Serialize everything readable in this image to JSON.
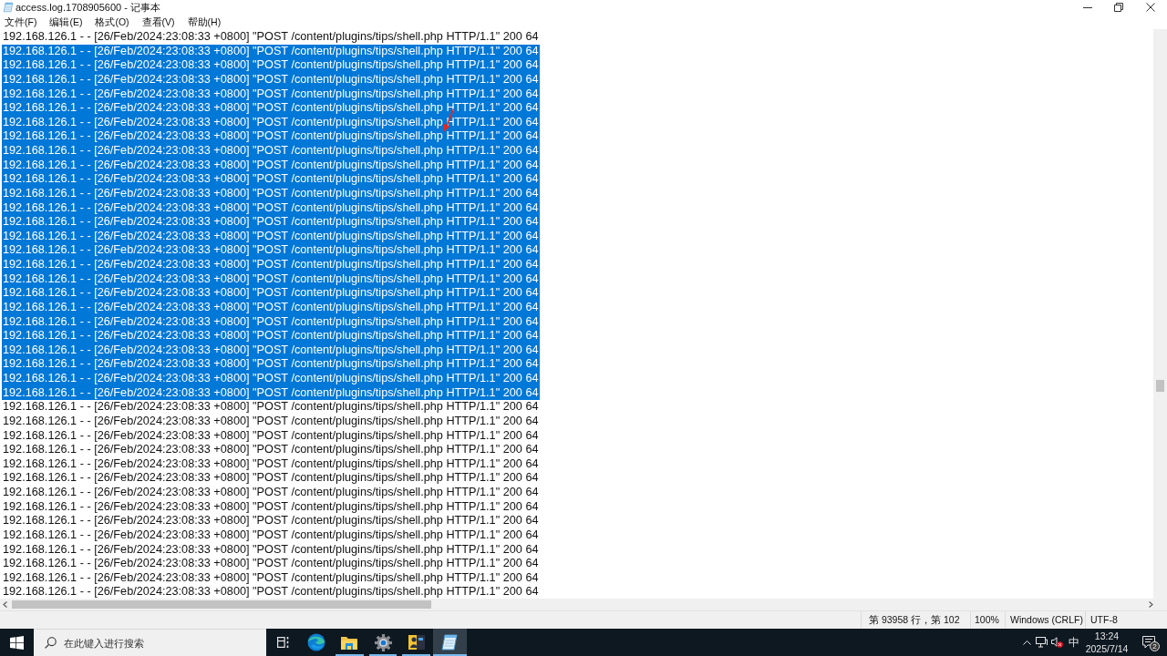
{
  "window": {
    "title": "access.log.1708905600 - 记事本"
  },
  "menu": [
    {
      "label": "文件(F)"
    },
    {
      "label": "编辑(E)"
    },
    {
      "label": "格式(O)"
    },
    {
      "label": "查看(V)"
    },
    {
      "label": "帮助(H)"
    }
  ],
  "editor": {
    "lines": [
      {
        "text": "192.168.126.1 - - [26/Feb/2024:23:08:33 +0800] \"POST /content/plugins/tips/shell.php HTTP/1.1\" 200 64",
        "selected": false
      },
      {
        "text": "192.168.126.1 - - [26/Feb/2024:23:08:33 +0800] \"POST /content/plugins/tips/shell.php HTTP/1.1\" 200 64",
        "selected": true
      },
      {
        "text": "192.168.126.1 - - [26/Feb/2024:23:08:33 +0800] \"POST /content/plugins/tips/shell.php HTTP/1.1\" 200 64",
        "selected": true
      },
      {
        "text": "192.168.126.1 - - [26/Feb/2024:23:08:33 +0800] \"POST /content/plugins/tips/shell.php HTTP/1.1\" 200 64",
        "selected": true
      },
      {
        "text": "192.168.126.1 - - [26/Feb/2024:23:08:33 +0800] \"POST /content/plugins/tips/shell.php HTTP/1.1\" 200 64",
        "selected": true
      },
      {
        "text": "192.168.126.1 - - [26/Feb/2024:23:08:33 +0800] \"POST /content/plugins/tips/shell.php HTTP/1.1\" 200 64",
        "selected": true
      },
      {
        "text": "192.168.126.1 - - [26/Feb/2024:23:08:33 +0800] \"POST /content/plugins/tips/shell.php HTTP/1.1\" 200 64",
        "selected": true
      },
      {
        "text": "192.168.126.1 - - [26/Feb/2024:23:08:33 +0800] \"POST /content/plugins/tips/shell.php HTTP/1.1\" 200 64",
        "selected": true
      },
      {
        "text": "192.168.126.1 - - [26/Feb/2024:23:08:33 +0800] \"POST /content/plugins/tips/shell.php HTTP/1.1\" 200 64",
        "selected": true
      },
      {
        "text": "192.168.126.1 - - [26/Feb/2024:23:08:33 +0800] \"POST /content/plugins/tips/shell.php HTTP/1.1\" 200 64",
        "selected": true
      },
      {
        "text": "192.168.126.1 - - [26/Feb/2024:23:08:33 +0800] \"POST /content/plugins/tips/shell.php HTTP/1.1\" 200 64",
        "selected": true
      },
      {
        "text": "192.168.126.1 - - [26/Feb/2024:23:08:33 +0800] \"POST /content/plugins/tips/shell.php HTTP/1.1\" 200 64",
        "selected": true
      },
      {
        "text": "192.168.126.1 - - [26/Feb/2024:23:08:33 +0800] \"POST /content/plugins/tips/shell.php HTTP/1.1\" 200 64",
        "selected": true
      },
      {
        "text": "192.168.126.1 - - [26/Feb/2024:23:08:33 +0800] \"POST /content/plugins/tips/shell.php HTTP/1.1\" 200 64",
        "selected": true
      },
      {
        "text": "192.168.126.1 - - [26/Feb/2024:23:08:33 +0800] \"POST /content/plugins/tips/shell.php HTTP/1.1\" 200 64",
        "selected": true
      },
      {
        "text": "192.168.126.1 - - [26/Feb/2024:23:08:33 +0800] \"POST /content/plugins/tips/shell.php HTTP/1.1\" 200 64",
        "selected": true
      },
      {
        "text": "192.168.126.1 - - [26/Feb/2024:23:08:33 +0800] \"POST /content/plugins/tips/shell.php HTTP/1.1\" 200 64",
        "selected": true
      },
      {
        "text": "192.168.126.1 - - [26/Feb/2024:23:08:33 +0800] \"POST /content/plugins/tips/shell.php HTTP/1.1\" 200 64",
        "selected": true
      },
      {
        "text": "192.168.126.1 - - [26/Feb/2024:23:08:33 +0800] \"POST /content/plugins/tips/shell.php HTTP/1.1\" 200 64",
        "selected": true
      },
      {
        "text": "192.168.126.1 - - [26/Feb/2024:23:08:33 +0800] \"POST /content/plugins/tips/shell.php HTTP/1.1\" 200 64",
        "selected": true
      },
      {
        "text": "192.168.126.1 - - [26/Feb/2024:23:08:33 +0800] \"POST /content/plugins/tips/shell.php HTTP/1.1\" 200 64",
        "selected": true
      },
      {
        "text": "192.168.126.1 - - [26/Feb/2024:23:08:33 +0800] \"POST /content/plugins/tips/shell.php HTTP/1.1\" 200 64",
        "selected": true
      },
      {
        "text": "192.168.126.1 - - [26/Feb/2024:23:08:33 +0800] \"POST /content/plugins/tips/shell.php HTTP/1.1\" 200 64",
        "selected": true
      },
      {
        "text": "192.168.126.1 - - [26/Feb/2024:23:08:33 +0800] \"POST /content/plugins/tips/shell.php HTTP/1.1\" 200 64",
        "selected": true
      },
      {
        "text": "192.168.126.1 - - [26/Feb/2024:23:08:33 +0800] \"POST /content/plugins/tips/shell.php HTTP/1.1\" 200 64",
        "selected": true
      },
      {
        "text": "192.168.126.1 - - [26/Feb/2024:23:08:33 +0800] \"POST /content/plugins/tips/shell.php HTTP/1.1\" 200 64",
        "selected": true
      },
      {
        "text": "192.168.126.1 - - [26/Feb/2024:23:08:33 +0800] \"POST /content/plugins/tips/shell.php HTTP/1.1\" 200 64",
        "selected": false
      },
      {
        "text": "192.168.126.1 - - [26/Feb/2024:23:08:33 +0800] \"POST /content/plugins/tips/shell.php HTTP/1.1\" 200 64",
        "selected": false
      },
      {
        "text": "192.168.126.1 - - [26/Feb/2024:23:08:33 +0800] \"POST /content/plugins/tips/shell.php HTTP/1.1\" 200 64",
        "selected": false
      },
      {
        "text": "192.168.126.1 - - [26/Feb/2024:23:08:33 +0800] \"POST /content/plugins/tips/shell.php HTTP/1.1\" 200 64",
        "selected": false
      },
      {
        "text": "192.168.126.1 - - [26/Feb/2024:23:08:33 +0800] \"POST /content/plugins/tips/shell.php HTTP/1.1\" 200 64",
        "selected": false
      },
      {
        "text": "192.168.126.1 - - [26/Feb/2024:23:08:33 +0800] \"POST /content/plugins/tips/shell.php HTTP/1.1\" 200 64",
        "selected": false
      },
      {
        "text": "192.168.126.1 - - [26/Feb/2024:23:08:33 +0800] \"POST /content/plugins/tips/shell.php HTTP/1.1\" 200 64",
        "selected": false
      },
      {
        "text": "192.168.126.1 - - [26/Feb/2024:23:08:33 +0800] \"POST /content/plugins/tips/shell.php HTTP/1.1\" 200 64",
        "selected": false
      },
      {
        "text": "192.168.126.1 - - [26/Feb/2024:23:08:33 +0800] \"POST /content/plugins/tips/shell.php HTTP/1.1\" 200 64",
        "selected": false
      },
      {
        "text": "192.168.126.1 - - [26/Feb/2024:23:08:33 +0800] \"POST /content/plugins/tips/shell.php HTTP/1.1\" 200 64",
        "selected": false
      },
      {
        "text": "192.168.126.1 - - [26/Feb/2024:23:08:33 +0800] \"POST /content/plugins/tips/shell.php HTTP/1.1\" 200 64",
        "selected": false
      },
      {
        "text": "192.168.126.1 - - [26/Feb/2024:23:08:33 +0800] \"POST /content/plugins/tips/shell.php HTTP/1.1\" 200 64",
        "selected": false
      },
      {
        "text": "192.168.126.1 - - [26/Feb/2024:23:08:33 +0800] \"POST /content/plugins/tips/shell.php HTTP/1.1\" 200 64",
        "selected": false
      },
      {
        "text": "192.168.126.1 - - [26/Feb/2024:23:08:33 +0800] \"POST /content/plugins/tips/shell.php HTTP/1.1\" 200 64",
        "selected": false
      }
    ]
  },
  "status_bar": {
    "position": "第 93958 行，第 102",
    "zoom": "100%",
    "line_ending": "Windows (CRLF)",
    "encoding": "UTF-8"
  },
  "taskbar": {
    "search": {
      "placeholder": "在此键入进行搜索"
    },
    "apps": [
      {
        "kind": "task-view",
        "selected": false,
        "running": false
      },
      {
        "kind": "browser",
        "selected": false,
        "running": false
      },
      {
        "kind": "folder",
        "selected": false,
        "running": true
      },
      {
        "kind": "settings",
        "selected": false,
        "running": true
      },
      {
        "kind": "app",
        "selected": false,
        "running": true
      },
      {
        "kind": "notepad",
        "selected": true,
        "running": true
      }
    ],
    "tray": {
      "ime": "中",
      "time": "13:24",
      "date": "2025/7/14",
      "notifications": "2"
    }
  }
}
